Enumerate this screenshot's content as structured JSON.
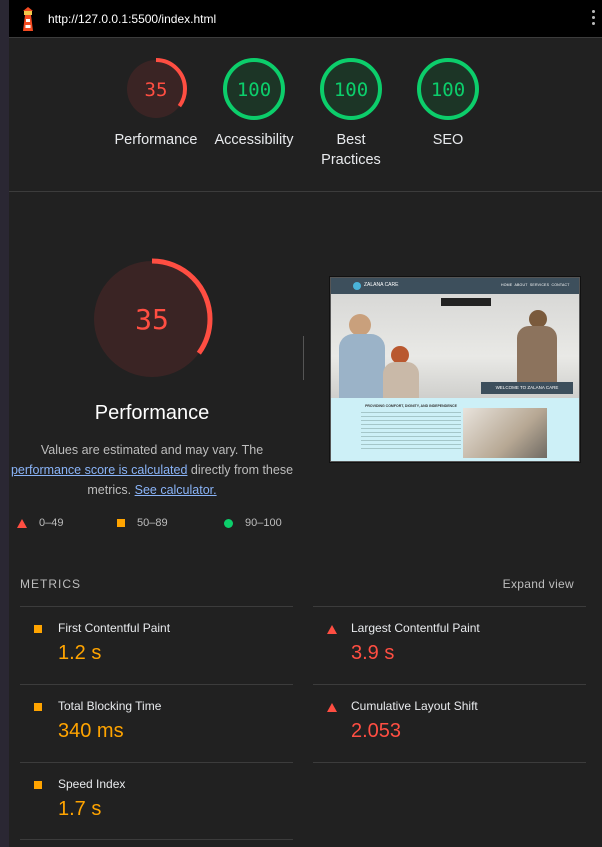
{
  "topbar": {
    "url": "http://127.0.0.1:5500/index.html",
    "logo_icon": "lighthouse-icon",
    "menu_icon": "more-vert-icon"
  },
  "gauges": [
    {
      "score": "35",
      "label": "Performance",
      "score_fraction": 0.35,
      "color": "#ff4e42",
      "bg": "#3a2424"
    },
    {
      "score": "100",
      "label": "Accessibility",
      "score_fraction": 1.0,
      "color": "#0cce6b",
      "bg": "#1c3526"
    },
    {
      "score": "100",
      "label": "Best Practices",
      "score_fraction": 1.0,
      "color": "#0cce6b",
      "bg": "#1c3526"
    },
    {
      "score": "100",
      "label": "SEO",
      "score_fraction": 1.0,
      "color": "#0cce6b",
      "bg": "#1c3526"
    }
  ],
  "performance": {
    "score": "35",
    "score_fraction": 0.35,
    "title": "Performance",
    "desc_1": "Values are estimated and may vary. The ",
    "desc_link_1": "performance score is calculated",
    "desc_2": " directly from these metrics. ",
    "desc_link_2": "See calculator."
  },
  "screenshot": {
    "brand": "ZALANA CARE",
    "nav": [
      "HOME",
      "ABOUT",
      "SERVICES",
      "CONTACT"
    ],
    "banner": "WELCOME TO ZALANA CARE",
    "section_title": "PROVIDING COMFORT, DIGNITY, AND INDEPENDENCE"
  },
  "legend": [
    {
      "range": "0–49",
      "icon": "triangle-icon"
    },
    {
      "range": "50–89",
      "icon": "square-icon"
    },
    {
      "range": "90–100",
      "icon": "circle-icon"
    }
  ],
  "metrics": {
    "title": "METRICS",
    "expand_label": "Expand view",
    "items": [
      {
        "name": "First Contentful Paint",
        "value": "1.2 s",
        "rating": "average"
      },
      {
        "name": "Largest Contentful Paint",
        "value": "3.9 s",
        "rating": "fail"
      },
      {
        "name": "Total Blocking Time",
        "value": "340 ms",
        "rating": "average"
      },
      {
        "name": "Cumulative Layout Shift",
        "value": "2.053",
        "rating": "fail"
      },
      {
        "name": "Speed Index",
        "value": "1.7 s",
        "rating": "average"
      }
    ]
  },
  "colors": {
    "fail": "#ff4e42",
    "average": "#ffa400",
    "pass": "#0cce6b"
  }
}
